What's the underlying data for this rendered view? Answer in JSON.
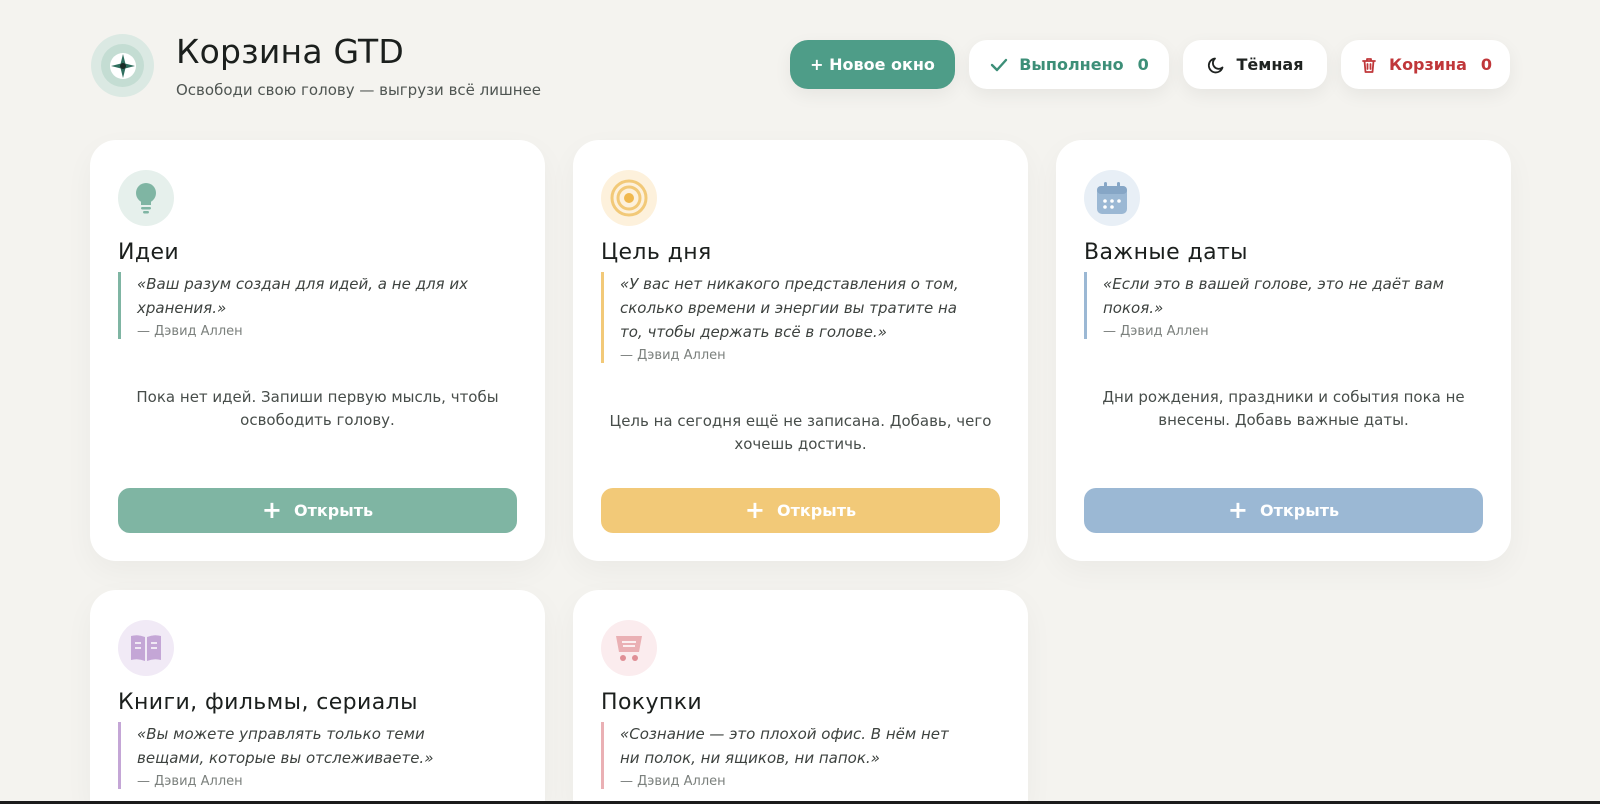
{
  "header": {
    "title": "Корзина GTD",
    "subtitle": "Освободи свою голову — выгрузи всё лишнее",
    "new_window_label": "+ Новое окно",
    "done_label": "Выполнено",
    "done_count": "0",
    "theme_label": "Тёмная",
    "trash_label": "Корзина",
    "trash_count": "0"
  },
  "colors": {
    "background": "#f4f3ef",
    "accent_green": "#4e9d88",
    "ideas": "#7fb5a3",
    "goal": "#f2c978",
    "dates": "#9bb8d4",
    "books": "#c4a6d6",
    "shopping": "#eab0b4",
    "danger": "#c0373a"
  },
  "cards": [
    {
      "icon": "lightbulb-icon",
      "title": "Идеи",
      "quote": "«Ваш разум создан для идей, а не для их хранения.»",
      "author": "— Дэвид Аллен",
      "empty": "Пока нет идей. Запиши первую мысль, чтобы освободить голову.",
      "button": "Открыть"
    },
    {
      "icon": "target-icon",
      "title": "Цель дня",
      "quote": "«У вас нет никакого представления о том, сколько времени и энергии вы тратите на то, чтобы держать всё в голове.»",
      "author": "— Дэвид Аллен",
      "empty": "Цель на сегодня ещё не записана. Добавь, чего хочешь достичь.",
      "button": "Открыть"
    },
    {
      "icon": "calendar-icon",
      "title": "Важные даты",
      "quote": "«Если это в вашей голове, это не даёт вам покоя.»",
      "author": "— Дэвид Аллен",
      "empty": "Дни рождения, праздники и события пока не внесены. Добавь важные даты.",
      "button": "Открыть"
    },
    {
      "icon": "book-icon",
      "title": "Книги, фильмы, сериалы",
      "quote": "«Вы можете управлять только теми вещами, которые вы отслеживаете.»",
      "author": "— Дэвид Аллен"
    },
    {
      "icon": "cart-icon",
      "title": "Покупки",
      "quote": "«Сознание — это плохой офис. В нём нет ни полок, ни ящиков, ни папок.»",
      "author": "— Дэвид Аллен"
    }
  ]
}
